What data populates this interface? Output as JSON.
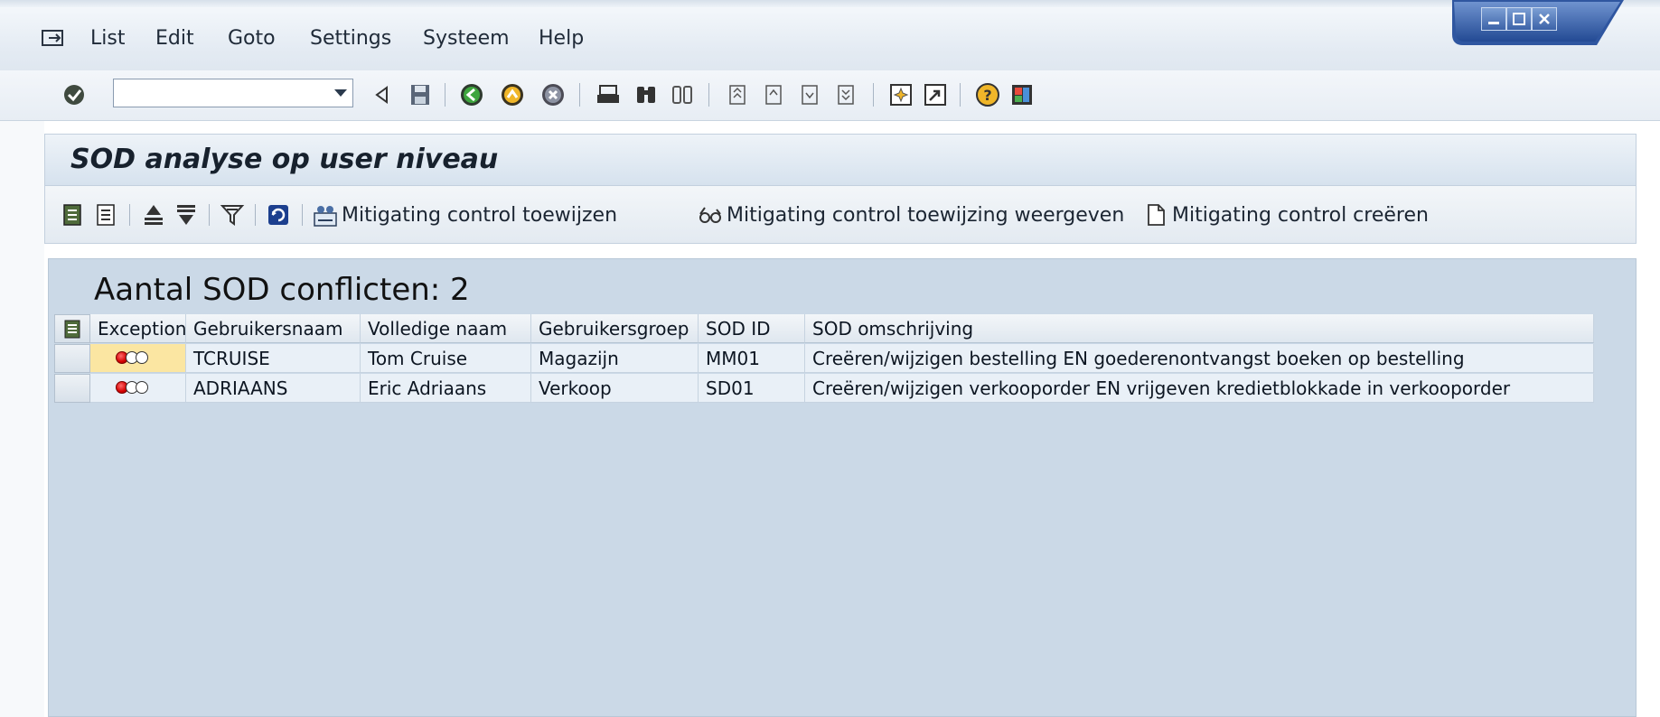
{
  "menu": {
    "items": [
      "List",
      "Edit",
      "Goto",
      "Settings",
      "Systeem",
      "Help"
    ]
  },
  "toolbar": {
    "command_field_value": ""
  },
  "page": {
    "title": "SOD analyse op user niveau"
  },
  "app_toolbar": {
    "assign_label": "Mitigating control toewijzen",
    "display_label": "Mitigating control toewijzing weergeven",
    "create_label": "Mitigating control creëren"
  },
  "list": {
    "title": "Aantal SOD conflicten: 2",
    "columns": [
      "Exception",
      "Gebruikersnaam",
      "Volledige naam",
      "Gebruikersgroep",
      "SOD ID",
      "SOD omschrijving"
    ],
    "rows": [
      {
        "exception": "red",
        "user": "TCRUISE",
        "full_name": "Tom Cruise",
        "group": "Magazijn",
        "sod_id": "MM01",
        "description": "Creëren/wijzigen bestelling EN goederenontvangst boeken op bestelling"
      },
      {
        "exception": "red",
        "user": "ADRIAANS",
        "full_name": "Eric Adriaans",
        "group": "Verkoop",
        "sod_id": "SD01",
        "description": "Creëren/wijzigen verkooporder EN vrijgeven kredietblokkade in verkooporder"
      }
    ]
  },
  "colors": {
    "title_bg": "#d6e2ee",
    "list_bg": "#cbd9e7",
    "exception_highlight": "#fbe6a2",
    "light_red": "#d40000"
  }
}
